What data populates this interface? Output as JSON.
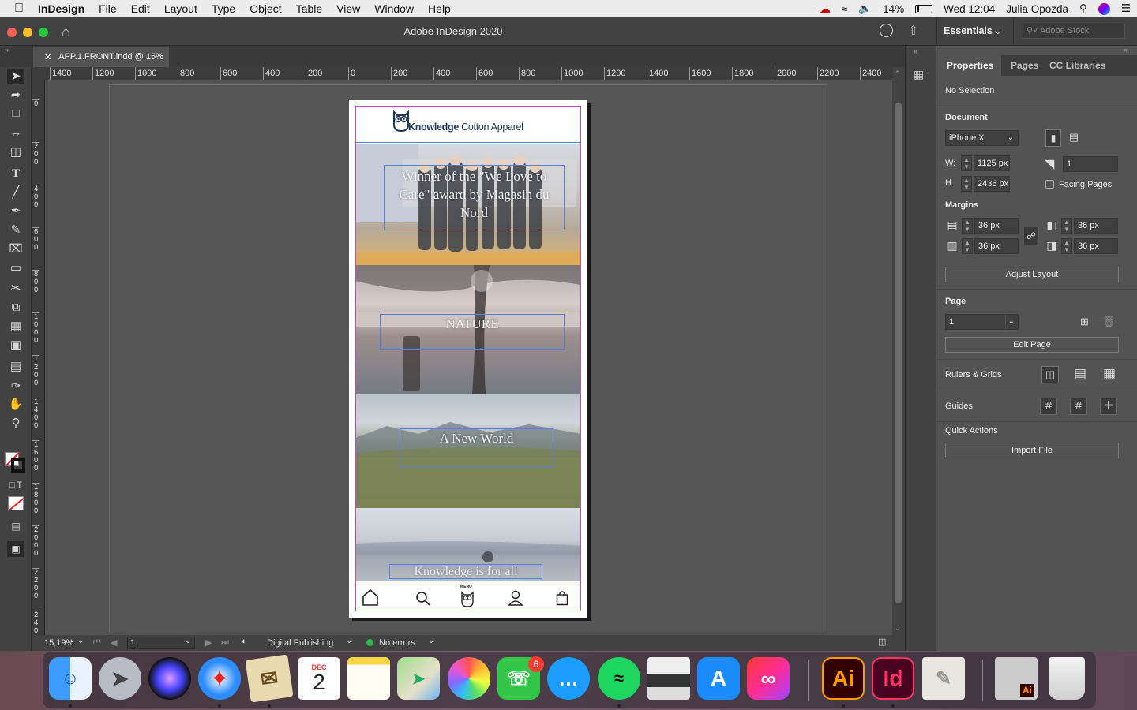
{
  "menubar": {
    "app": "InDesign",
    "items": [
      "File",
      "Edit",
      "Layout",
      "Type",
      "Object",
      "Table",
      "View",
      "Window",
      "Help"
    ],
    "battery": "14%",
    "clock": "Wed 12:04",
    "user": "Julia Opozda"
  },
  "titlebar": {
    "title": "Adobe InDesign 2020",
    "workspace": "Essentials",
    "search_placeholder": "Adobe Stock"
  },
  "doc_tab": {
    "label": "APP.1.FRONT.indd @ 15%",
    "close": "✕"
  },
  "ruler": {
    "h_labels": [
      "1400",
      "1200",
      "1000",
      "800",
      "600",
      "400",
      "200",
      "0",
      "200",
      "400",
      "600",
      "800",
      "1000",
      "1200",
      "1400",
      "1600",
      "1800",
      "2000",
      "2200",
      "2400"
    ],
    "v_labels": [
      "0",
      "200",
      "400",
      "600",
      "800",
      "1000",
      "1200",
      "1400",
      "1600",
      "1800",
      "2000",
      "2200",
      "2400"
    ]
  },
  "page": {
    "logo_text_bold": "Knowledge",
    "logo_text_rest": " Cotton Apparel",
    "text_frames": [
      "Winner of the \"We Love to Care\" award by Magasin du Nord",
      "NATURE",
      "A New World",
      "Knowledge is for all"
    ],
    "menu_label": "MENU"
  },
  "statusbar": {
    "zoom": "15,19%",
    "page": "1",
    "mode": "Digital Publishing",
    "errors": "No errors"
  },
  "properties": {
    "tabs": [
      "Properties",
      "Pages",
      "CC Libraries"
    ],
    "selection": "No Selection",
    "document_title": "Document",
    "preset": "iPhone X",
    "w_label": "W:",
    "w_value": "1125 px",
    "h_label": "H:",
    "h_value": "2436 px",
    "pages_value": "1",
    "facing_pages": "Facing Pages",
    "margins_title": "Margins",
    "margin_top": "36 px",
    "margin_bottom": "36 px",
    "margin_left": "36 px",
    "margin_right": "36 px",
    "adjust_layout": "Adjust Layout",
    "page_title": "Page",
    "page_value": "1",
    "edit_page": "Edit Page",
    "rulers_grids": "Rulers & Grids",
    "guides": "Guides",
    "quick_actions": "Quick Actions",
    "import_file": "Import File"
  },
  "dock": {
    "calendar_month": "DEC",
    "calendar_day": "2",
    "facetime_badge": "6",
    "ai_label": "Ai",
    "id_label": "Id"
  },
  "colors": {
    "accent_ai": "#ff9a00",
    "bg_ai": "#330000",
    "accent_id": "#ff3366",
    "bg_id": "#49021f",
    "margin_guide": "#c44bc4",
    "frame_edge": "#5b7fd6"
  }
}
